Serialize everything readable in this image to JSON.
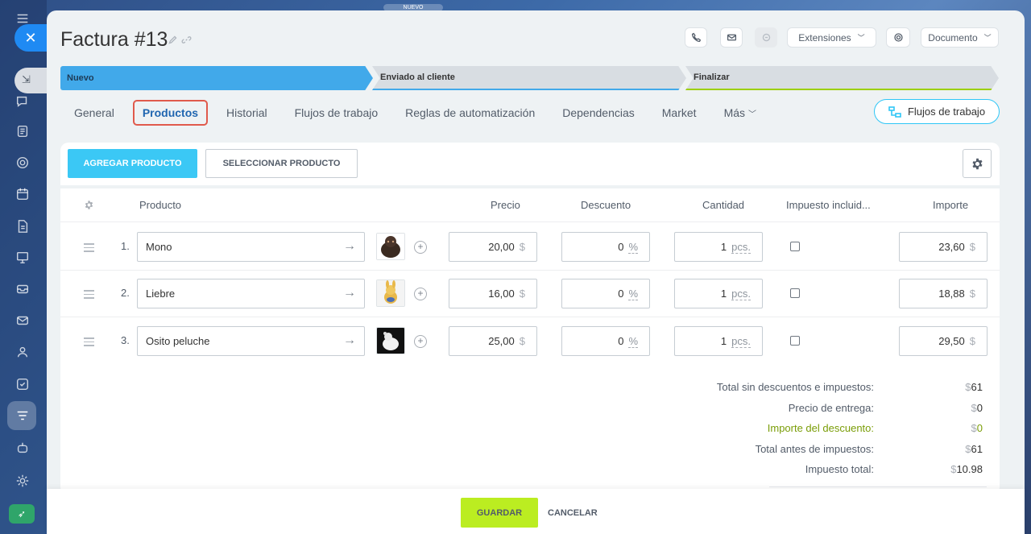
{
  "topbar": {
    "badge": "NUEVO"
  },
  "document": {
    "title": "Factura #13"
  },
  "header": {
    "extensions_label": "Extensiones",
    "document_label": "Documento"
  },
  "stages": [
    {
      "label": "Nuevo",
      "color": "#41a9ea"
    },
    {
      "label": "Enviado al cliente",
      "color": "#41a9ea"
    },
    {
      "label": "Finalizar",
      "color": "#9dcf00"
    }
  ],
  "tabs": [
    {
      "label": "General"
    },
    {
      "label": "Productos",
      "active": true
    },
    {
      "label": "Historial"
    },
    {
      "label": "Flujos de trabajo"
    },
    {
      "label": "Reglas de automatización"
    },
    {
      "label": "Dependencias"
    },
    {
      "label": "Market"
    },
    {
      "label": "Más"
    }
  ],
  "workflow_button": "Flujos de trabajo",
  "toolbar": {
    "add_label": "AGREGAR PRODUCTO",
    "select_label": "SELECCIONAR PRODUCTO"
  },
  "table": {
    "headers": {
      "product": "Producto",
      "price": "Precio",
      "discount": "Descuento",
      "quantity": "Cantidad",
      "tax": "Impuesto incluid...",
      "amount": "Importe"
    },
    "rows": [
      {
        "num": "1.",
        "name": "Mono",
        "price": "20,00",
        "currency": "$",
        "discount": "0",
        "discount_unit": "%",
        "qty": "1",
        "qty_unit": "pcs.",
        "amount": "23,60"
      },
      {
        "num": "2.",
        "name": "Liebre",
        "price": "16,00",
        "currency": "$",
        "discount": "0",
        "discount_unit": "%",
        "qty": "1",
        "qty_unit": "pcs.",
        "amount": "18,88"
      },
      {
        "num": "3.",
        "name": "Osito peluche",
        "price": "25,00",
        "currency": "$",
        "discount": "0",
        "discount_unit": "%",
        "qty": "1",
        "qty_unit": "pcs.",
        "amount": "29,50"
      }
    ]
  },
  "totals": [
    {
      "label": "Total sin descuentos e impuestos:",
      "currency": "$",
      "value": "61"
    },
    {
      "label": "Precio de entrega:",
      "currency": "$",
      "value": "0"
    },
    {
      "label": "Importe del descuento:",
      "currency": "$",
      "value": "0",
      "green": true
    },
    {
      "label": "Total antes de impuestos:",
      "currency": "$",
      "value": "61"
    },
    {
      "label": "Impuesto total:",
      "currency": "$",
      "value": "10.98"
    }
  ],
  "footer": {
    "save_label": "GUARDAR",
    "cancel_label": "CANCELAR"
  }
}
